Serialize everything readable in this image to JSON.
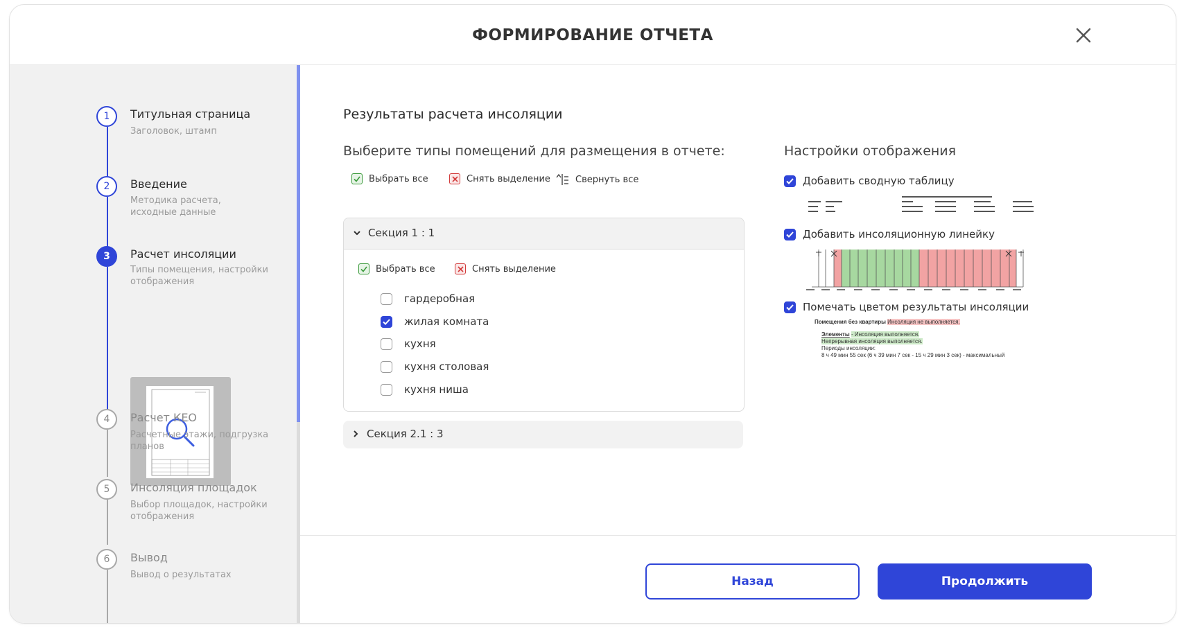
{
  "header": {
    "title": "ФОРМИРОВАНИЕ ОТЧЕТА"
  },
  "sidebar": {
    "steps": [
      {
        "number": "1",
        "title": "Титульная страница",
        "subtitle": "Заголовок, штамп"
      },
      {
        "number": "2",
        "title": "Введение",
        "subtitle": "Методика расчета, исходные данные"
      },
      {
        "number": "3",
        "title": "Расчет инсоляции",
        "subtitle": "Типы помещения, настройки отображения"
      },
      {
        "number": "4",
        "title": "Расчет КЕО",
        "subtitle": "Расчетные этажи, подгрузка планов"
      },
      {
        "number": "5",
        "title": "Инсоляция площадок",
        "subtitle": "Выбор площадок, настройки отображения"
      },
      {
        "number": "6",
        "title": "Вывод",
        "subtitle": "Вывод о результатах"
      }
    ],
    "active_step": 3
  },
  "main": {
    "title": "Результаты расчета инсоляции",
    "rooms_heading": "Выберите типы помещений для размещения в отчете:",
    "toolbar": {
      "select_all": "Выбрать все",
      "deselect": "Снять выделение",
      "collapse_all": "Свернуть все"
    },
    "sections": [
      {
        "label": "Секция 1 : 1",
        "expanded": true,
        "select_all": "Выбрать все",
        "deselect": "Снять выделение",
        "items": [
          {
            "label": "гардеробная",
            "checked": false
          },
          {
            "label": "жилая комната",
            "checked": true
          },
          {
            "label": "кухня",
            "checked": false
          },
          {
            "label": "кухня столовая",
            "checked": false
          },
          {
            "label": "кухня ниша",
            "checked": false
          }
        ]
      },
      {
        "label": "Секция 2.1 : 3",
        "expanded": false
      }
    ],
    "settings": {
      "heading": "Настройки отображения",
      "options": [
        {
          "label": "Добавить сводную таблицу",
          "checked": true
        },
        {
          "label": "Добавить инсоляционную линейку",
          "checked": true
        },
        {
          "label": "Помечать цветом результаты инсоляции",
          "checked": true
        }
      ],
      "color_sample": {
        "group_title": "Помещения без квартиры",
        "group_status": "Инсоляция не выполняется.",
        "elements_label": "Элементы",
        "elements_status": "- Инсоляция выполняется.",
        "continuous_status": "Непрерывная инсоляция выполняется.",
        "periods_label": "Периоды инсоляции:",
        "periods_value": "8 ч 49 мин 55 сек (6 ч 39 мин 7 сек - 15 ч 29 мин 3 сек) - максимальный"
      }
    }
  },
  "footer": {
    "back_label": "Назад",
    "continue_label": "Продолжить"
  },
  "colors": {
    "accent": "#2f45d8",
    "accent_light": "#7f91ef",
    "ok_green": "#a7d8a0",
    "fail_red": "#f2a3a3"
  }
}
